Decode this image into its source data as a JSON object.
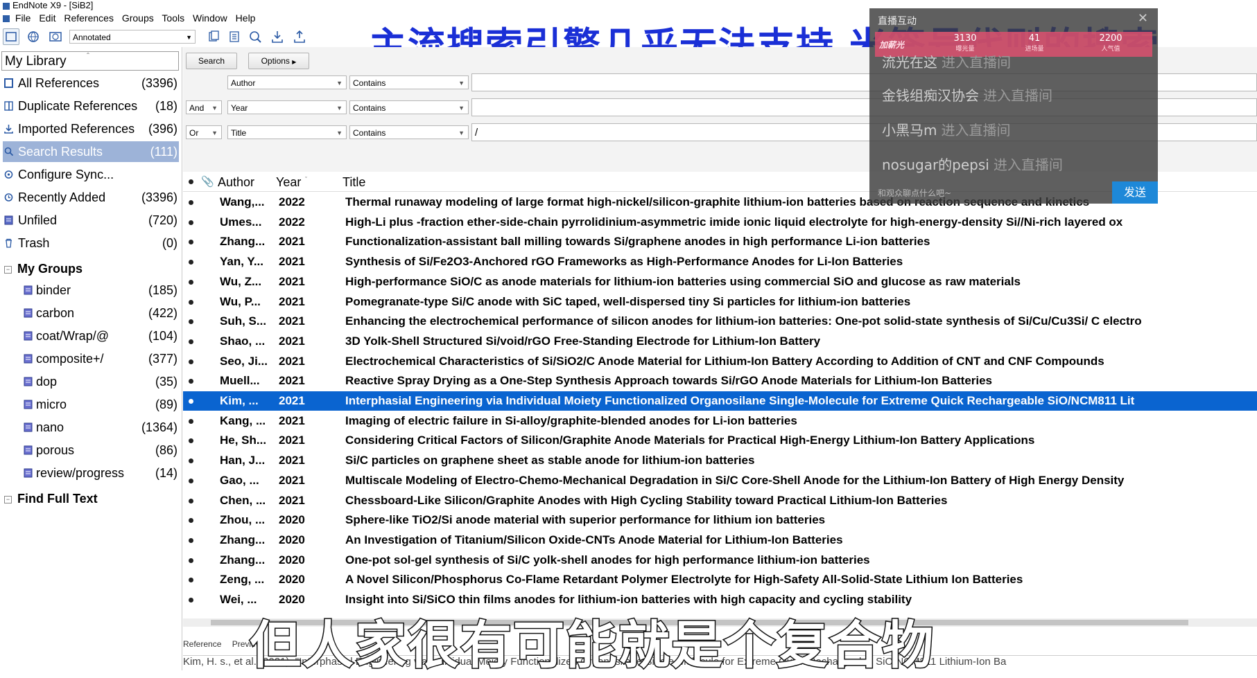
{
  "window": {
    "title": "EndNote X9 - [SiB2]"
  },
  "menu": [
    "File",
    "Edit",
    "References",
    "Groups",
    "Tools",
    "Window",
    "Help"
  ],
  "toolbar": {
    "style": "Annotated"
  },
  "headline": "主流搜索引擎几乎无法支持 米签号代则的搜索",
  "sidebar": {
    "library_title": "My Library",
    "items": [
      {
        "label": "All References",
        "count": "(3396)",
        "icon": "library-icon"
      },
      {
        "label": "Duplicate References",
        "count": "(18)",
        "icon": "duplicate-icon"
      },
      {
        "label": "Imported References",
        "count": "(396)",
        "icon": "import-icon"
      },
      {
        "label": "Search Results",
        "count": "(111)",
        "icon": "search-icon"
      },
      {
        "label": "Configure Sync...",
        "count": "",
        "icon": "sync-icon"
      },
      {
        "label": "Recently Added",
        "count": "(3396)",
        "icon": "clock-icon"
      },
      {
        "label": "Unfiled",
        "count": "(720)",
        "icon": "unfiled-icon"
      },
      {
        "label": "Trash",
        "count": "(0)",
        "icon": "trash-icon"
      }
    ],
    "my_groups_label": "My Groups",
    "groups": [
      {
        "label": "binder",
        "count": "(185)"
      },
      {
        "label": "carbon",
        "count": "(422)"
      },
      {
        "label": "coat/Wrap/@",
        "count": "(104)"
      },
      {
        "label": "composite+/",
        "count": "(377)"
      },
      {
        "label": "dop",
        "count": "(35)"
      },
      {
        "label": "micro",
        "count": "(89)"
      },
      {
        "label": "nano",
        "count": "(1364)"
      },
      {
        "label": "porous",
        "count": "(86)"
      },
      {
        "label": "review/progress",
        "count": "(14)"
      }
    ],
    "find_full_text_label": "Find Full Text"
  },
  "search": {
    "search_btn": "Search",
    "options_btn": "Options",
    "rows": [
      {
        "bool": "",
        "field": "Author",
        "op": "Contains",
        "value": ""
      },
      {
        "bool": "And",
        "field": "Year",
        "op": "Contains",
        "value": ""
      },
      {
        "bool": "Or",
        "field": "Title",
        "op": "Contains",
        "value": "/"
      }
    ]
  },
  "columns": {
    "author": "Author",
    "year": "Year",
    "title": "Title"
  },
  "references": [
    {
      "author": "Wang,...",
      "year": "2022",
      "title": "Thermal runaway modeling of large format high-nickel/silicon-graphite lithium-ion batteries based on reaction sequence and kinetics"
    },
    {
      "author": "Umes...",
      "year": "2022",
      "title": "High-Li plus -fraction ether-side-chain pyrrolidinium-asymmetric imide ionic liquid electrolyte for high-energy-density Si//Ni-rich layered ox"
    },
    {
      "author": "Zhang...",
      "year": "2021",
      "title": "Functionalization-assistant ball milling towards Si/graphene anodes in high performance Li-ion batteries"
    },
    {
      "author": "Yan, Y...",
      "year": "2021",
      "title": "Synthesis of Si/Fe2O3-Anchored rGO Frameworks as High-Performance Anodes for Li-Ion Batteries"
    },
    {
      "author": "Wu, Z...",
      "year": "2021",
      "title": "High-performance SiO/C as anode materials for lithium-ion batteries using commercial SiO and glucose as raw materials"
    },
    {
      "author": "Wu, P...",
      "year": "2021",
      "title": "Pomegranate-type Si/C anode with SiC taped, well-dispersed tiny Si particles for lithium-ion batteries"
    },
    {
      "author": "Suh, S...",
      "year": "2021",
      "title": "Enhancing the electrochemical performance of silicon anodes for lithium-ion batteries: One-pot solid-state synthesis of Si/Cu/Cu3Si/ C electro"
    },
    {
      "author": "Shao, ...",
      "year": "2021",
      "title": "3D Yolk-Shell Structured Si/void/rGO Free-Standing Electrode for Lithium-Ion Battery"
    },
    {
      "author": "Seo, Ji...",
      "year": "2021",
      "title": "Electrochemical Characteristics of Si/SiO2/C Anode Material for Lithium-Ion Battery According to Addition of CNT and CNF Compounds"
    },
    {
      "author": "Muell...",
      "year": "2021",
      "title": "Reactive Spray Drying as a One-Step Synthesis Approach towards Si/rGO Anode Materials for Lithium-Ion Batteries"
    },
    {
      "author": "Kim, ...",
      "year": "2021",
      "title": "Interphasial Engineering via Individual Moiety Functionalized Organosilane Single-Molecule for Extreme Quick Rechargeable SiO/NCM811 Lit",
      "selected": true
    },
    {
      "author": "Kang, ...",
      "year": "2021",
      "title": "Imaging of electric failure in Si-alloy/graphite-blended anodes for Li-ion batteries"
    },
    {
      "author": "He, Sh...",
      "year": "2021",
      "title": "Considering Critical Factors of Silicon/Graphite Anode Materials for Practical High-Energy Lithium-Ion Battery Applications"
    },
    {
      "author": "Han, J...",
      "year": "2021",
      "title": "Si/C particles on graphene sheet as stable anode for lithium-ion batteries"
    },
    {
      "author": "Gao, ...",
      "year": "2021",
      "title": "Multiscale Modeling of Electro-Chemo-Mechanical Degradation in Si/C Core-Shell Anode for the Lithium-Ion Battery of High Energy Density"
    },
    {
      "author": "Chen, ...",
      "year": "2021",
      "title": "Chessboard-Like Silicon/Graphite Anodes with High Cycling Stability toward Practical Lithium-Ion Batteries"
    },
    {
      "author": "Zhou, ...",
      "year": "2020",
      "title": "Sphere-like TiO2/Si anode material with superior performance for lithium ion batteries"
    },
    {
      "author": "Zhang...",
      "year": "2020",
      "title": "An Investigation of Titanium/Silicon Oxide-CNTs Anode Material for Lithium-Ion Batteries"
    },
    {
      "author": "Zhang...",
      "year": "2020",
      "title": "One-pot sol-gel synthesis of Si/C yolk-shell anodes for high performance lithium-ion batteries"
    },
    {
      "author": "Zeng, ...",
      "year": "2020",
      "title": "A Novel Silicon/Phosphorus Co-Flame Retardant Polymer Electrolyte for High-Safety All-Solid-State Lithium Ion Batteries"
    },
    {
      "author": "Wei, ...",
      "year": "2020",
      "title": "Insight into Si/SiCO thin films anodes for lithium-ion batteries with high capacity and cycling stability"
    }
  ],
  "chat": {
    "header": "直播互动",
    "pk": "加薪光",
    "stats": [
      {
        "value": "3130",
        "label": "曝光量"
      },
      {
        "value": "41",
        "label": "进场量"
      },
      {
        "value": "2200",
        "label": "人气值"
      }
    ],
    "messages": [
      {
        "user": "流光在这",
        "action": "进入直播间"
      },
      {
        "user": "金钱组痴汉协会",
        "action": "进入直播间"
      },
      {
        "user": "小黑马m",
        "action": "进入直播间"
      },
      {
        "user": "nosugar的pepsi",
        "action": "进入直播间"
      }
    ],
    "input_placeholder": "和观众聊点什么吧~",
    "send_label": "发送"
  },
  "bottom_tabs": [
    "Reference",
    "Preview"
  ],
  "preview_text": "Kim, H. s., et al. (2021). \"Interphasial Engineering via Individual Moiety Functionalized Organosilane Single-Molecule for Extreme Quick Rechargeable SiO/NCM811 Lithium-Ion Ba",
  "subtitle": "但人家很有可能就是个复合物",
  "colors": {
    "selected_row": "#0a64d0",
    "sidebar_selected": "#9db3d8",
    "headline": "#1a2fd6",
    "chat_send": "#1e88d8"
  }
}
